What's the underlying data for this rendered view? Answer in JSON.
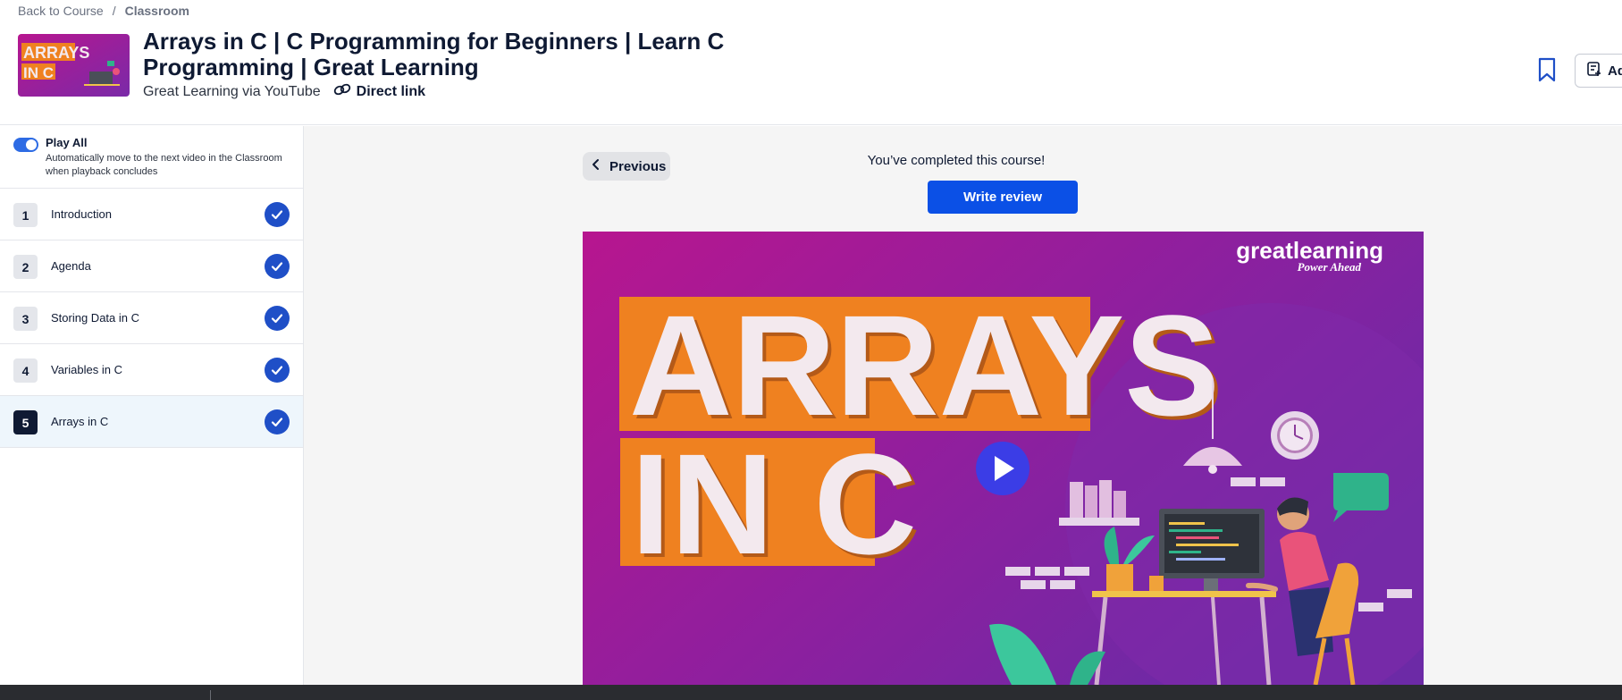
{
  "breadcrumb": {
    "back": "Back to Course",
    "separator": "/",
    "current": "Classroom"
  },
  "header": {
    "title": "Arrays in C | C Programming for Beginners | Learn C Programming | Great Learning",
    "provider": "Great Learning via YouTube",
    "direct_link": "Direct link",
    "add_label": "Ad"
  },
  "thumbnail": {
    "line1": "ARRAYS",
    "line2": "IN C"
  },
  "playall": {
    "label": "Play All",
    "description": "Automatically move to the next video in the Classroom when playback concludes",
    "enabled": true
  },
  "lessons": [
    {
      "num": "1",
      "name": "Introduction",
      "completed": true
    },
    {
      "num": "2",
      "name": "Agenda",
      "completed": true
    },
    {
      "num": "3",
      "name": "Storing Data in C",
      "completed": true
    },
    {
      "num": "4",
      "name": "Variables in C",
      "completed": true
    },
    {
      "num": "5",
      "name": "Arrays in C",
      "completed": true,
      "active": true
    }
  ],
  "main": {
    "previous_label": "Previous",
    "completed_text": "You’ve completed this course!",
    "review_label": "Write review"
  },
  "video": {
    "brand": "greatlearning",
    "tagline": "Power Ahead",
    "title_line1": "ARRAYS",
    "title_line2": "IN C"
  },
  "colors": {
    "primary": "#0b50e6",
    "check": "#1f4fc7",
    "video_orange": "#ef8120",
    "video_magenta": "#b7168f",
    "video_purple": "#7a2aa8"
  }
}
